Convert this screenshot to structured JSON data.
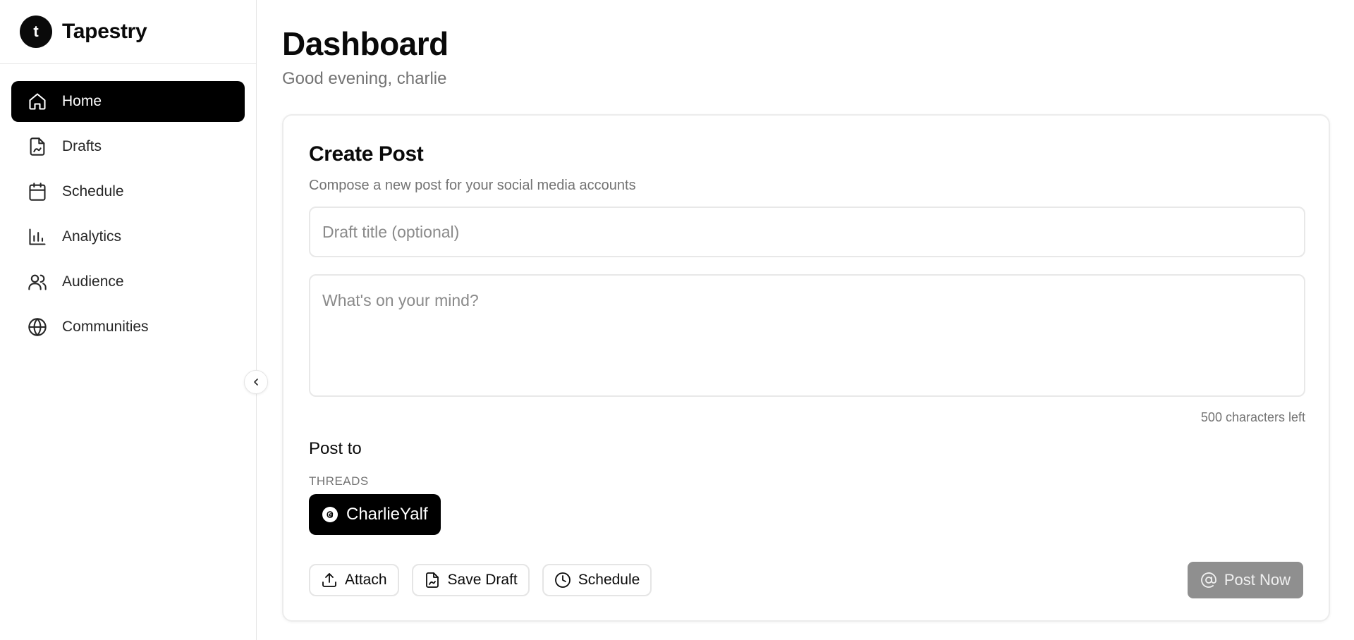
{
  "brand": {
    "logo_letter": "t",
    "name": "Tapestry"
  },
  "sidebar": {
    "items": [
      {
        "label": "Home",
        "icon": "home-icon",
        "active": true
      },
      {
        "label": "Drafts",
        "icon": "file-signature-icon",
        "active": false
      },
      {
        "label": "Schedule",
        "icon": "calendar-icon",
        "active": false
      },
      {
        "label": "Analytics",
        "icon": "bar-chart-icon",
        "active": false
      },
      {
        "label": "Audience",
        "icon": "users-icon",
        "active": false
      },
      {
        "label": "Communities",
        "icon": "globe-icon",
        "active": false
      }
    ],
    "collapse_icon": "chevron-left-icon"
  },
  "header": {
    "title": "Dashboard",
    "subtitle": "Good evening, charlie"
  },
  "composer": {
    "title": "Create Post",
    "description": "Compose a new post for your social media accounts",
    "draft_title_placeholder": "Draft title (optional)",
    "draft_title_value": "",
    "body_placeholder": "What's on your mind?",
    "body_value": "",
    "char_count": "500 characters left",
    "post_to_label": "Post to",
    "platform": "THREADS",
    "account": {
      "name": "CharlieYalf",
      "icon": "threads-icon"
    },
    "actions": {
      "attach_label": "Attach",
      "save_draft_label": "Save Draft",
      "schedule_label": "Schedule",
      "post_now_label": "Post Now"
    }
  },
  "colors": {
    "accent": "#000000",
    "border": "#e5e5e5",
    "muted_text": "#737373",
    "disabled_button": "#8f8f8f"
  }
}
